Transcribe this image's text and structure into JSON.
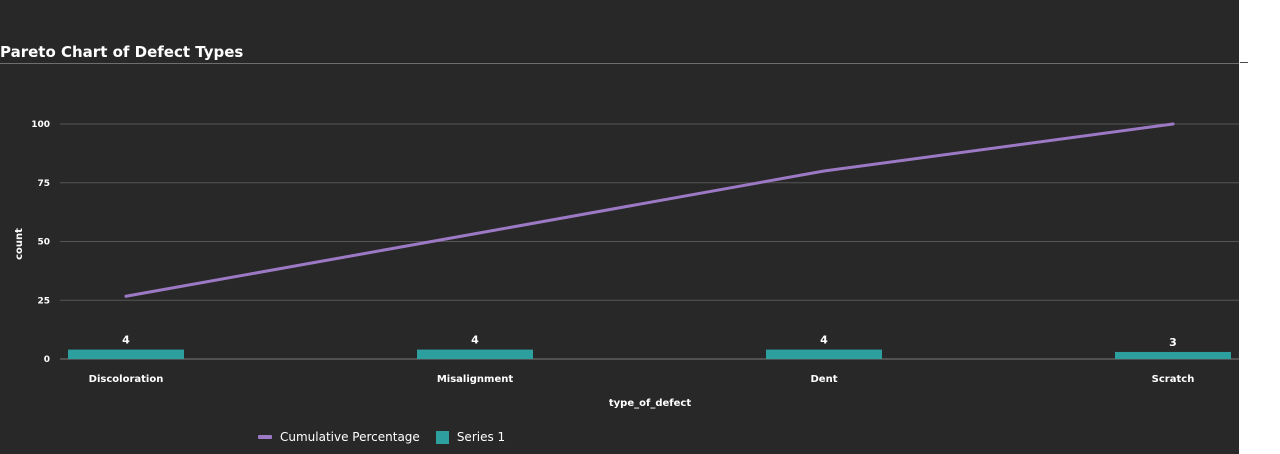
{
  "chart_data": {
    "type": "bar",
    "title": "Pareto Chart of Defect Types",
    "xlabel": "type_of_defect",
    "ylabel": "count",
    "categories": [
      "Discoloration",
      "Misalignment",
      "Dent",
      "Scratch"
    ],
    "ylim": [
      0,
      100
    ],
    "yticks": [
      0,
      25,
      50,
      75,
      100
    ],
    "grid": true,
    "legend_position": "bottom-left",
    "series": [
      {
        "name": "Cumulative Percentage",
        "type": "line",
        "values": [
          26.7,
          53.3,
          80.0,
          100.0
        ],
        "color": "#9c79c4"
      },
      {
        "name": "Series 1",
        "type": "bar",
        "values": [
          4,
          4,
          4,
          3
        ],
        "color": "#2e9f9f",
        "data_labels": [
          "4",
          "4",
          "4",
          "3"
        ]
      }
    ]
  }
}
